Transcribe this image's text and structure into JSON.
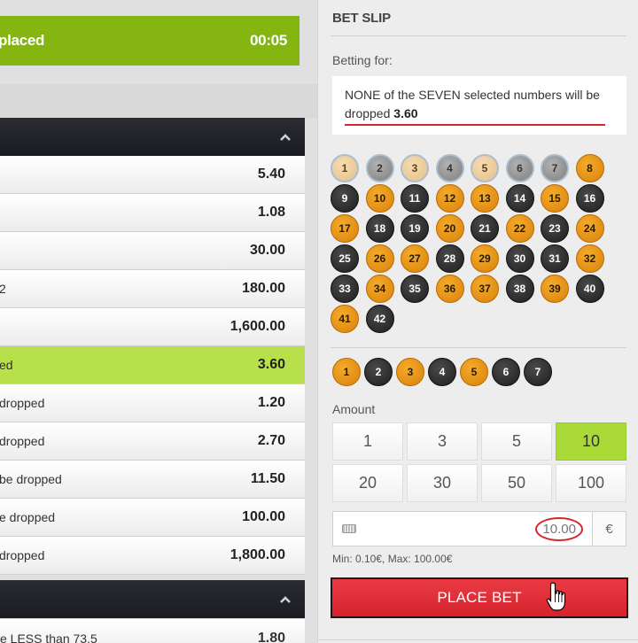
{
  "banner": {
    "text": "placed",
    "time": "00:05"
  },
  "odds_rows": [
    {
      "label": "",
      "value": "5.40"
    },
    {
      "label": "",
      "value": "1.08"
    },
    {
      "label": "",
      "value": "30.00"
    },
    {
      "label": "2",
      "value": "180.00"
    },
    {
      "label": "",
      "value": "1,600.00"
    },
    {
      "label": "ed",
      "value": "3.60",
      "selected": true
    },
    {
      "label": "dropped",
      "value": "1.20"
    },
    {
      "label": "dropped",
      "value": "2.70"
    },
    {
      "label": "be dropped",
      "value": "11.50"
    },
    {
      "label": "e dropped",
      "value": "100.00"
    },
    {
      "label": "dropped",
      "value": "1,800.00"
    }
  ],
  "second_section_row": {
    "label": "e LESS than 73.5",
    "value": "1.80"
  },
  "bet_slip": {
    "title": "BET SLIP",
    "betting_for_label": "Betting for:",
    "description": "NONE of the SEVEN selected numbers will be dropped",
    "description_odds": "3.60",
    "numbers": [
      {
        "n": "1",
        "c": "sel-orange"
      },
      {
        "n": "2",
        "c": "sel-black"
      },
      {
        "n": "3",
        "c": "sel-orange"
      },
      {
        "n": "4",
        "c": "sel-black"
      },
      {
        "n": "5",
        "c": "sel-orange"
      },
      {
        "n": "6",
        "c": "sel-black"
      },
      {
        "n": "7",
        "c": "sel-black"
      },
      {
        "n": "8",
        "c": "orange"
      },
      {
        "n": "9",
        "c": "black"
      },
      {
        "n": "10",
        "c": "orange"
      },
      {
        "n": "11",
        "c": "black"
      },
      {
        "n": "12",
        "c": "orange"
      },
      {
        "n": "13",
        "c": "orange"
      },
      {
        "n": "14",
        "c": "black"
      },
      {
        "n": "15",
        "c": "orange"
      },
      {
        "n": "16",
        "c": "black"
      },
      {
        "n": "17",
        "c": "orange"
      },
      {
        "n": "18",
        "c": "black"
      },
      {
        "n": "19",
        "c": "black"
      },
      {
        "n": "20",
        "c": "orange"
      },
      {
        "n": "21",
        "c": "black"
      },
      {
        "n": "22",
        "c": "orange"
      },
      {
        "n": "23",
        "c": "black"
      },
      {
        "n": "24",
        "c": "orange"
      },
      {
        "n": "25",
        "c": "black"
      },
      {
        "n": "26",
        "c": "orange"
      },
      {
        "n": "27",
        "c": "orange"
      },
      {
        "n": "28",
        "c": "black"
      },
      {
        "n": "29",
        "c": "orange"
      },
      {
        "n": "30",
        "c": "black"
      },
      {
        "n": "31",
        "c": "black"
      },
      {
        "n": "32",
        "c": "orange"
      },
      {
        "n": "33",
        "c": "black"
      },
      {
        "n": "34",
        "c": "orange"
      },
      {
        "n": "35",
        "c": "black"
      },
      {
        "n": "36",
        "c": "orange"
      },
      {
        "n": "37",
        "c": "orange"
      },
      {
        "n": "38",
        "c": "black"
      },
      {
        "n": "39",
        "c": "orange"
      },
      {
        "n": "40",
        "c": "black"
      },
      {
        "n": "41",
        "c": "orange"
      },
      {
        "n": "42",
        "c": "black"
      }
    ],
    "picked": [
      {
        "n": "1",
        "c": "orange"
      },
      {
        "n": "2",
        "c": "black"
      },
      {
        "n": "3",
        "c": "orange"
      },
      {
        "n": "4",
        "c": "black"
      },
      {
        "n": "5",
        "c": "orange"
      },
      {
        "n": "6",
        "c": "black"
      },
      {
        "n": "7",
        "c": "black"
      }
    ],
    "amount_label": "Amount",
    "amounts": [
      {
        "v": "1"
      },
      {
        "v": "3"
      },
      {
        "v": "5"
      },
      {
        "v": "10",
        "active": true
      },
      {
        "v": "20"
      },
      {
        "v": "30"
      },
      {
        "v": "50"
      },
      {
        "v": "100"
      }
    ],
    "stake_value": "10.00",
    "currency": "€",
    "minmax": "Min: 0.10€, Max: 100.00€",
    "place_bet": "PLACE BET"
  },
  "colors": {
    "green": "#84b511",
    "selected_row": "#b7e04a",
    "place_bet": "#d9242c",
    "orange_ball": "#e8940f"
  },
  "icons": [
    "chevron-up-icon",
    "keyboard-icon",
    "hand-cursor-icon"
  ]
}
